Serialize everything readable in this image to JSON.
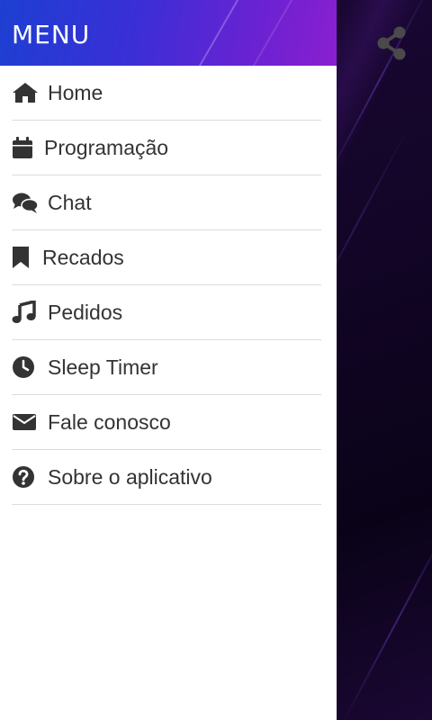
{
  "drawer": {
    "title": "MENU",
    "items": [
      {
        "label": "Home",
        "icon": "home-icon"
      },
      {
        "label": "Programação",
        "icon": "calendar-icon"
      },
      {
        "label": "Chat",
        "icon": "chat-icon"
      },
      {
        "label": "Recados",
        "icon": "bookmark-icon"
      },
      {
        "label": "Pedidos",
        "icon": "music-icon"
      },
      {
        "label": "Sleep Timer",
        "icon": "clock-icon"
      },
      {
        "label": "Fale conosco",
        "icon": "envelope-icon"
      },
      {
        "label": "Sobre o aplicativo",
        "icon": "question-icon"
      }
    ]
  },
  "topbar": {
    "share_icon": "share-icon"
  },
  "colors": {
    "header_gradient_start": "#1d3fd2",
    "header_gradient_end": "#8a1fd0",
    "icon_color": "#333333",
    "background": "#120626"
  }
}
